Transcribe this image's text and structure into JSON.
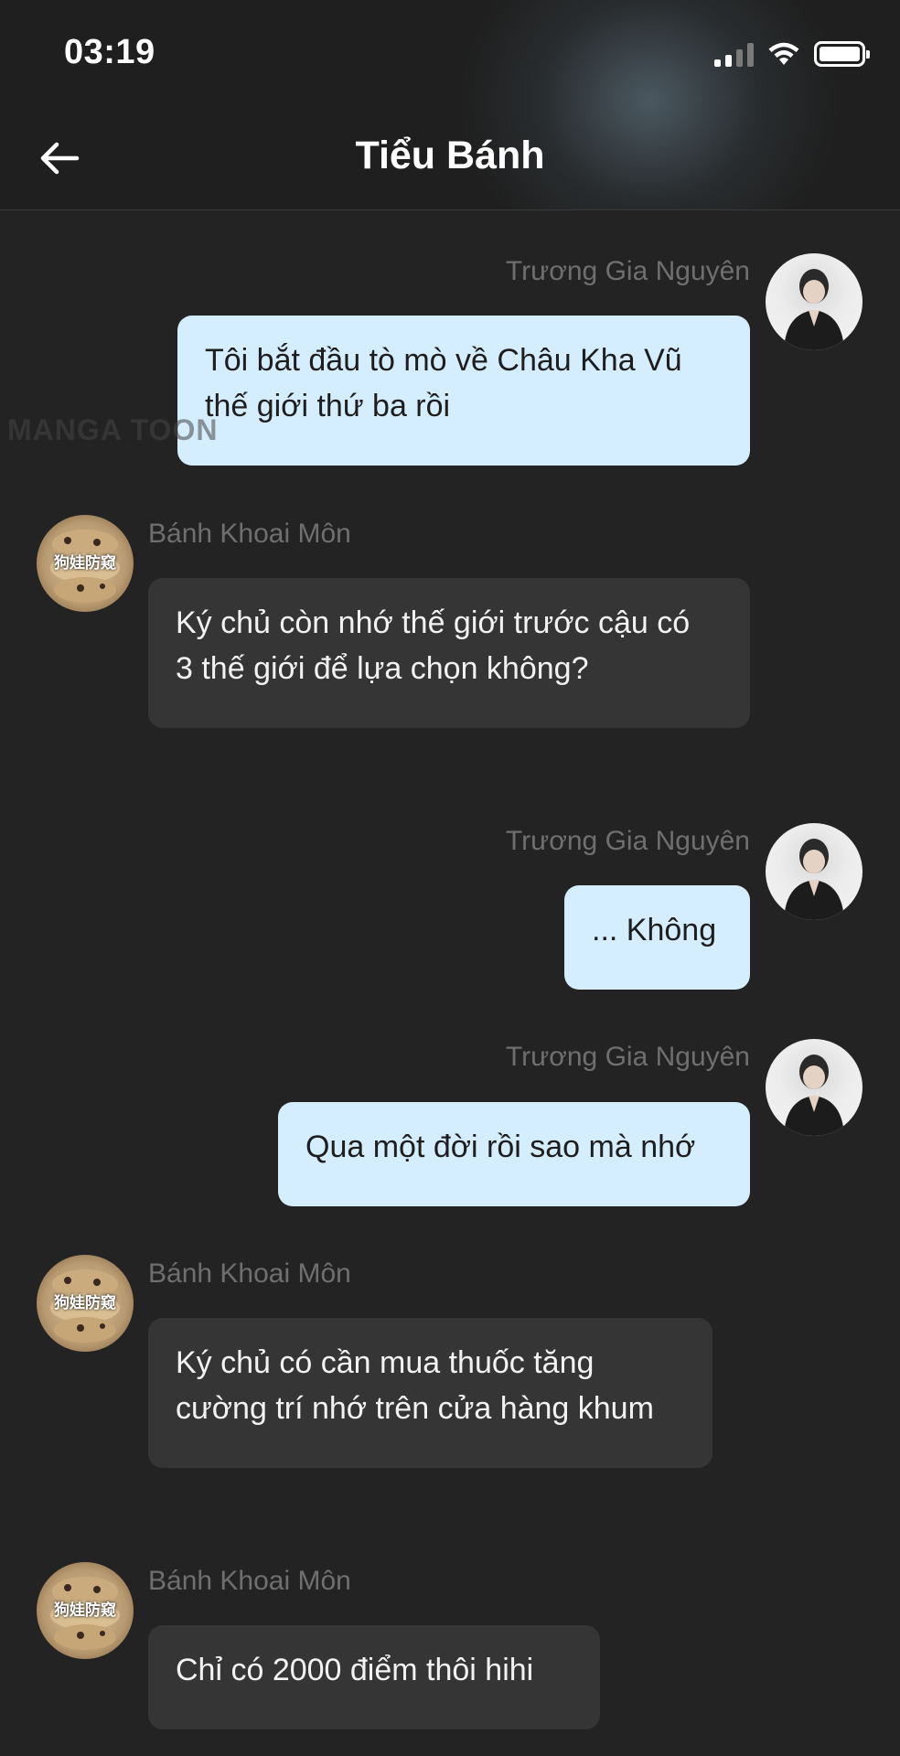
{
  "status_bar": {
    "time": "03:19",
    "signal_icon": "cellular-signal-icon",
    "wifi_icon": "wifi-icon",
    "battery_icon": "battery-icon"
  },
  "header": {
    "title": "Tiểu Bánh",
    "back_icon": "back-arrow-icon"
  },
  "watermark": "MANGA TOON",
  "messages": [
    {
      "sender": "Trương Gia Nguyên",
      "text_lines": [
        "Tôi bắt đầu tò mò về Châu Kha Vũ",
        "thế giới thứ ba rồi"
      ],
      "direction": "outgoing"
    },
    {
      "sender": "Bánh Khoai Môn",
      "text_lines": [
        "Ký chủ còn nhớ thế giới trước cậu có",
        "3 thế giới để lựa chọn không?"
      ],
      "direction": "incoming"
    },
    {
      "sender": "Trương Gia Nguyên",
      "text_lines": [
        "... Không"
      ],
      "direction": "outgoing"
    },
    {
      "sender": "Trương Gia Nguyên",
      "text_lines": [
        "Qua một đời rồi sao mà nhớ"
      ],
      "direction": "outgoing"
    },
    {
      "sender": "Bánh Khoai Môn",
      "text_lines": [
        "Ký chủ có cần mua thuốc tăng",
        "cường trí nhớ trên cửa hàng khum"
      ],
      "direction": "incoming"
    },
    {
      "sender": "Bánh Khoai Môn",
      "text_lines": [
        "Chỉ có 2000 điểm thôi hihi"
      ],
      "direction": "incoming"
    }
  ],
  "bot_avatar_text": "狗娃防窥",
  "colors": {
    "background": "#232323",
    "outgoing_bubble": "#d4eeff",
    "incoming_bubble": "#353535",
    "sender_name": "#6f6f6f"
  }
}
